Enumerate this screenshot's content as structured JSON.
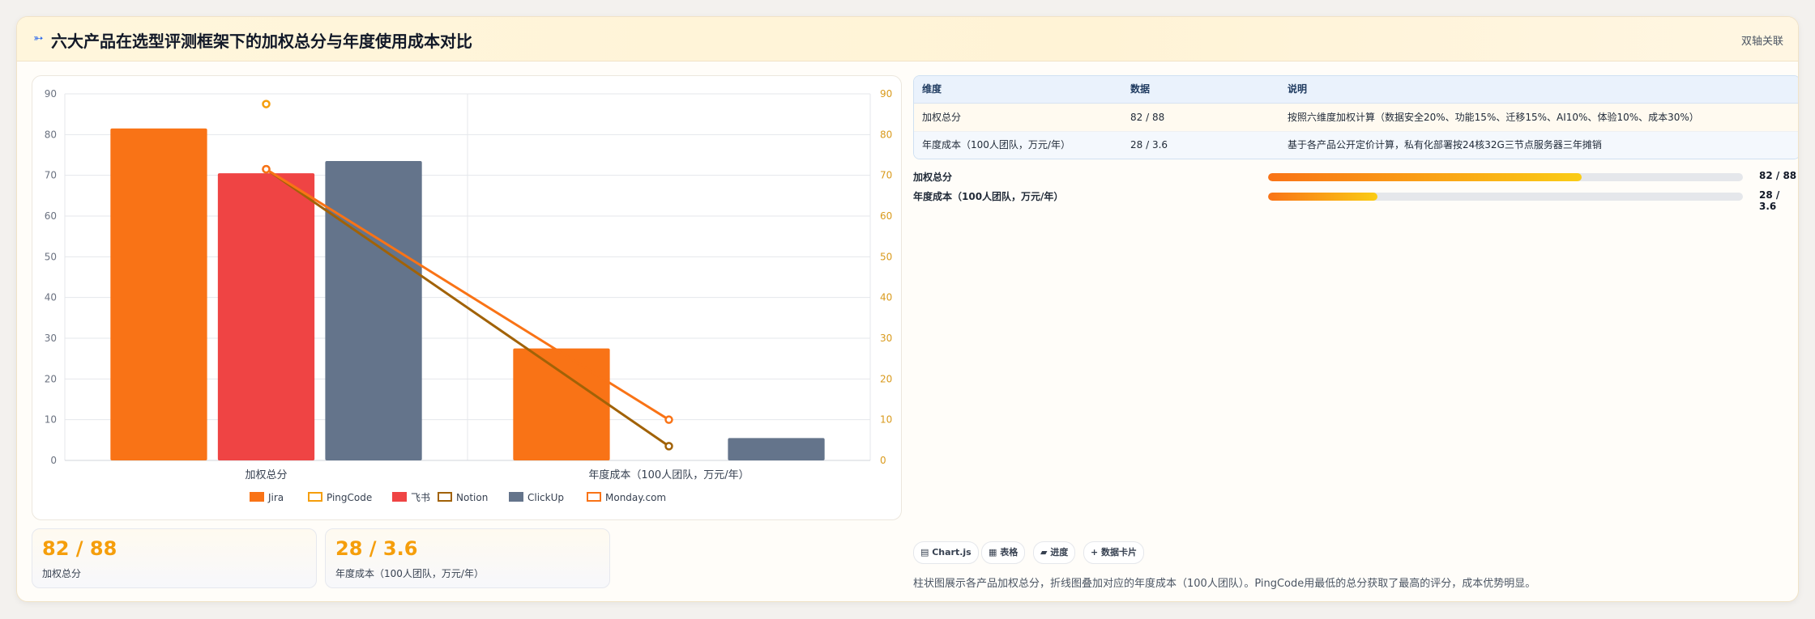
{
  "header": {
    "icon": "blue-arrow-icon",
    "title": "六大产品在选型评测框架下的加权总分与年度使用成本对比",
    "tag": "双轴关联"
  },
  "chart_data": {
    "type": "bar",
    "categories": [
      "加权总分",
      "年度成本（100人团队，万元/年）"
    ],
    "ylim": [
      0,
      90
    ],
    "y2lim": [
      0,
      90
    ],
    "yticks": [
      0,
      10,
      20,
      30,
      40,
      50,
      60,
      70,
      80,
      90
    ],
    "grid": true,
    "legend_position": "bottom",
    "series": [
      {
        "name": "Jira",
        "kind": "bar",
        "color": "#f97316",
        "values": [
          81.5,
          27.5
        ]
      },
      {
        "name": "PingCode",
        "kind": "line",
        "axis": "right",
        "color": "#f59e0b",
        "values": [
          87.5,
          null
        ]
      },
      {
        "name": "飞书",
        "kind": "bar",
        "color": "#ef4444",
        "values": [
          70.5,
          null
        ]
      },
      {
        "name": "Notion",
        "kind": "line",
        "axis": "right",
        "color": "#a16207",
        "values": [
          71.5,
          3.5
        ]
      },
      {
        "name": "ClickUp",
        "kind": "bar",
        "color": "#64748b",
        "values": [
          73.5,
          5.5
        ]
      },
      {
        "name": "Monday.com",
        "kind": "line",
        "axis": "right",
        "color": "#f97316",
        "values": [
          71.5,
          10
        ]
      }
    ]
  },
  "stats": [
    {
      "value": "82 / 88",
      "label": "加权总分"
    },
    {
      "value": "28 / 3.6",
      "label": "年度成本（100人团队，万元/年）"
    }
  ],
  "table": {
    "headers": [
      "维度",
      "数据",
      "说明"
    ],
    "rows": [
      [
        "加权总分",
        "82 / 88",
        "按照六维度加权计算（数据安全20%、功能15%、迁移15%、AI10%、体验10%、成本30%）"
      ],
      [
        "年度成本（100人团队，万元/年）",
        "28 / 3.6",
        "基于各产品公开定价计算，私有化部署按24核32G三节点服务器三年摊销"
      ]
    ]
  },
  "progress": [
    {
      "label": "加权总分",
      "value": "82 / 88",
      "fraction": 0.66
    },
    {
      "label": "年度成本（100人团队，万元/年）",
      "value": "28 / 3.6",
      "fraction": 0.23
    }
  ],
  "chips": [
    "▤ Chart.js",
    "▦ 表格",
    "▰ 进度",
    "+ 数据卡片"
  ],
  "note": "柱状图展示各产品加权总分，折线图叠加对应的年度成本（100人团队）。PingCode用最低的总分获取了最高的评分，成本优势明显。"
}
